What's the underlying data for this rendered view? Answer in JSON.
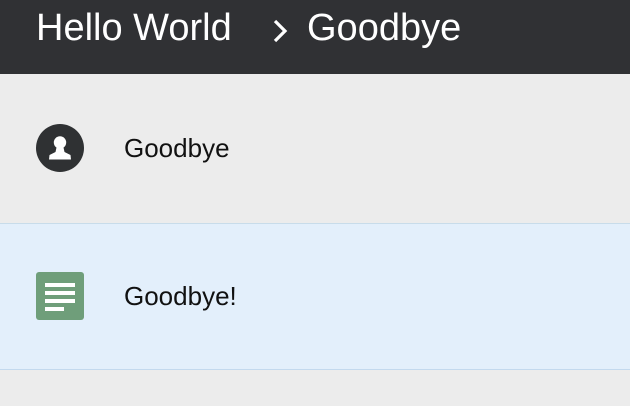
{
  "header": {
    "breadcrumb_root": "Hello World",
    "breadcrumb_separator_icon": "chevron-right-icon",
    "breadcrumb_current": "Goodbye"
  },
  "list": {
    "items": [
      {
        "label": "Goodbye",
        "icon": "person-icon",
        "selected": false
      },
      {
        "label": "Goodbye!",
        "icon": "document-icon",
        "selected": true
      }
    ]
  },
  "colors": {
    "header_bg": "#303134",
    "list_bg": "#ececec",
    "selected_bg": "#e3effb",
    "person_icon": "#2f3133",
    "document_icon": "#6f9e7a"
  }
}
